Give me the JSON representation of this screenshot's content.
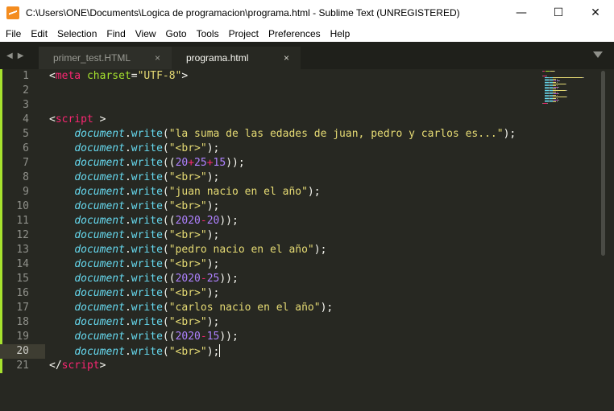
{
  "window": {
    "title": "C:\\Users\\ONE\\Documents\\Logica de programacion\\programa.html - Sublime Text (UNREGISTERED)",
    "controls": {
      "minimize": "—",
      "maximize": "☐",
      "close": "✕"
    }
  },
  "menu": [
    "File",
    "Edit",
    "Selection",
    "Find",
    "View",
    "Goto",
    "Tools",
    "Project",
    "Preferences",
    "Help"
  ],
  "tabs": [
    {
      "label": "primer_test.HTML",
      "active": false
    },
    {
      "label": "programa.html",
      "active": true
    }
  ],
  "tab_close_glyph": "×",
  "nav_arrows": {
    "back": "◀",
    "forward": "▶"
  },
  "editor": {
    "current_line": 20,
    "lines": [
      {
        "n": "1",
        "tokens": [
          [
            "tk-p",
            "<"
          ],
          [
            "tk-tag",
            "meta"
          ],
          [
            "tk-p",
            " "
          ],
          [
            "tk-attr",
            "charset"
          ],
          [
            "tk-p",
            "="
          ],
          [
            "tk-str",
            "\"UTF-8\""
          ],
          [
            "tk-p",
            ">"
          ]
        ]
      },
      {
        "n": "2",
        "tokens": []
      },
      {
        "n": "3",
        "tokens": []
      },
      {
        "n": "4",
        "tokens": [
          [
            "tk-p",
            "<"
          ],
          [
            "tk-tag",
            "script"
          ],
          [
            "tk-p",
            " >"
          ]
        ]
      },
      {
        "n": "5",
        "tokens": [
          [
            "tk-p",
            "    "
          ],
          [
            "tk-obj",
            "document"
          ],
          [
            "tk-p",
            "."
          ],
          [
            "tk-fn",
            "write"
          ],
          [
            "tk-p",
            "("
          ],
          [
            "tk-str",
            "\"la suma de las edades de juan, pedro y carlos es...\""
          ],
          [
            "tk-p",
            ");"
          ]
        ]
      },
      {
        "n": "6",
        "tokens": [
          [
            "tk-p",
            "    "
          ],
          [
            "tk-obj",
            "document"
          ],
          [
            "tk-p",
            "."
          ],
          [
            "tk-fn",
            "write"
          ],
          [
            "tk-p",
            "("
          ],
          [
            "tk-str",
            "\"<br>\""
          ],
          [
            "tk-p",
            ");"
          ]
        ]
      },
      {
        "n": "7",
        "tokens": [
          [
            "tk-p",
            "    "
          ],
          [
            "tk-obj",
            "document"
          ],
          [
            "tk-p",
            "."
          ],
          [
            "tk-fn",
            "write"
          ],
          [
            "tk-p",
            "(("
          ],
          [
            "tk-num",
            "20"
          ],
          [
            "tk-op",
            "+"
          ],
          [
            "tk-num",
            "25"
          ],
          [
            "tk-op",
            "+"
          ],
          [
            "tk-num",
            "15"
          ],
          [
            "tk-p",
            "));"
          ]
        ]
      },
      {
        "n": "8",
        "tokens": [
          [
            "tk-p",
            "    "
          ],
          [
            "tk-obj",
            "document"
          ],
          [
            "tk-p",
            "."
          ],
          [
            "tk-fn",
            "write"
          ],
          [
            "tk-p",
            "("
          ],
          [
            "tk-str",
            "\"<br>\""
          ],
          [
            "tk-p",
            ");"
          ]
        ]
      },
      {
        "n": "9",
        "tokens": [
          [
            "tk-p",
            "    "
          ],
          [
            "tk-obj",
            "document"
          ],
          [
            "tk-p",
            "."
          ],
          [
            "tk-fn",
            "write"
          ],
          [
            "tk-p",
            "("
          ],
          [
            "tk-str",
            "\"juan nacio en el año\""
          ],
          [
            "tk-p",
            ");"
          ]
        ]
      },
      {
        "n": "10",
        "tokens": [
          [
            "tk-p",
            "    "
          ],
          [
            "tk-obj",
            "document"
          ],
          [
            "tk-p",
            "."
          ],
          [
            "tk-fn",
            "write"
          ],
          [
            "tk-p",
            "("
          ],
          [
            "tk-str",
            "\"<br>\""
          ],
          [
            "tk-p",
            ");"
          ]
        ]
      },
      {
        "n": "11",
        "tokens": [
          [
            "tk-p",
            "    "
          ],
          [
            "tk-obj",
            "document"
          ],
          [
            "tk-p",
            "."
          ],
          [
            "tk-fn",
            "write"
          ],
          [
            "tk-p",
            "(("
          ],
          [
            "tk-num",
            "2020"
          ],
          [
            "tk-op",
            "-"
          ],
          [
            "tk-num",
            "20"
          ],
          [
            "tk-p",
            "));"
          ]
        ]
      },
      {
        "n": "12",
        "tokens": [
          [
            "tk-p",
            "    "
          ],
          [
            "tk-obj",
            "document"
          ],
          [
            "tk-p",
            "."
          ],
          [
            "tk-fn",
            "write"
          ],
          [
            "tk-p",
            "("
          ],
          [
            "tk-str",
            "\"<br>\""
          ],
          [
            "tk-p",
            ");"
          ]
        ]
      },
      {
        "n": "13",
        "tokens": [
          [
            "tk-p",
            "    "
          ],
          [
            "tk-obj",
            "document"
          ],
          [
            "tk-p",
            "."
          ],
          [
            "tk-fn",
            "write"
          ],
          [
            "tk-p",
            "("
          ],
          [
            "tk-str",
            "\"pedro nacio en el año\""
          ],
          [
            "tk-p",
            ");"
          ]
        ]
      },
      {
        "n": "14",
        "tokens": [
          [
            "tk-p",
            "    "
          ],
          [
            "tk-obj",
            "document"
          ],
          [
            "tk-p",
            "."
          ],
          [
            "tk-fn",
            "write"
          ],
          [
            "tk-p",
            "("
          ],
          [
            "tk-str",
            "\"<br>\""
          ],
          [
            "tk-p",
            ");"
          ]
        ]
      },
      {
        "n": "15",
        "tokens": [
          [
            "tk-p",
            "    "
          ],
          [
            "tk-obj",
            "document"
          ],
          [
            "tk-p",
            "."
          ],
          [
            "tk-fn",
            "write"
          ],
          [
            "tk-p",
            "(("
          ],
          [
            "tk-num",
            "2020"
          ],
          [
            "tk-op",
            "-"
          ],
          [
            "tk-num",
            "25"
          ],
          [
            "tk-p",
            "));"
          ]
        ]
      },
      {
        "n": "16",
        "tokens": [
          [
            "tk-p",
            "    "
          ],
          [
            "tk-obj",
            "document"
          ],
          [
            "tk-p",
            "."
          ],
          [
            "tk-fn",
            "write"
          ],
          [
            "tk-p",
            "("
          ],
          [
            "tk-str",
            "\"<br>\""
          ],
          [
            "tk-p",
            ");"
          ]
        ]
      },
      {
        "n": "17",
        "tokens": [
          [
            "tk-p",
            "    "
          ],
          [
            "tk-obj",
            "document"
          ],
          [
            "tk-p",
            "."
          ],
          [
            "tk-fn",
            "write"
          ],
          [
            "tk-p",
            "("
          ],
          [
            "tk-str",
            "\"carlos nacio en el año\""
          ],
          [
            "tk-p",
            ");"
          ]
        ]
      },
      {
        "n": "18",
        "tokens": [
          [
            "tk-p",
            "    "
          ],
          [
            "tk-obj",
            "document"
          ],
          [
            "tk-p",
            "."
          ],
          [
            "tk-fn",
            "write"
          ],
          [
            "tk-p",
            "("
          ],
          [
            "tk-str",
            "\"<br>\""
          ],
          [
            "tk-p",
            ");"
          ]
        ]
      },
      {
        "n": "19",
        "tokens": [
          [
            "tk-p",
            "    "
          ],
          [
            "tk-obj",
            "document"
          ],
          [
            "tk-p",
            "."
          ],
          [
            "tk-fn",
            "write"
          ],
          [
            "tk-p",
            "(("
          ],
          [
            "tk-num",
            "2020"
          ],
          [
            "tk-op",
            "-"
          ],
          [
            "tk-num",
            "15"
          ],
          [
            "tk-p",
            "));"
          ]
        ]
      },
      {
        "n": "20",
        "tokens": [
          [
            "tk-p",
            "    "
          ],
          [
            "tk-obj",
            "document"
          ],
          [
            "tk-p",
            "."
          ],
          [
            "tk-fn",
            "write"
          ],
          [
            "tk-p",
            "("
          ],
          [
            "tk-str",
            "\"<br>\""
          ],
          [
            "tk-p",
            ");"
          ]
        ]
      },
      {
        "n": "21",
        "tokens": [
          [
            "tk-p",
            "</"
          ],
          [
            "tk-tag",
            "script"
          ],
          [
            "tk-p",
            ">"
          ]
        ]
      }
    ]
  },
  "colors": {
    "background": "#272822",
    "tag": "#f92672",
    "attribute": "#a6e22e",
    "string": "#e6db74",
    "object": "#66d9ef",
    "number": "#ae81ff",
    "gutter_text": "#8f908a",
    "modified_marker": "#a6e22e"
  }
}
